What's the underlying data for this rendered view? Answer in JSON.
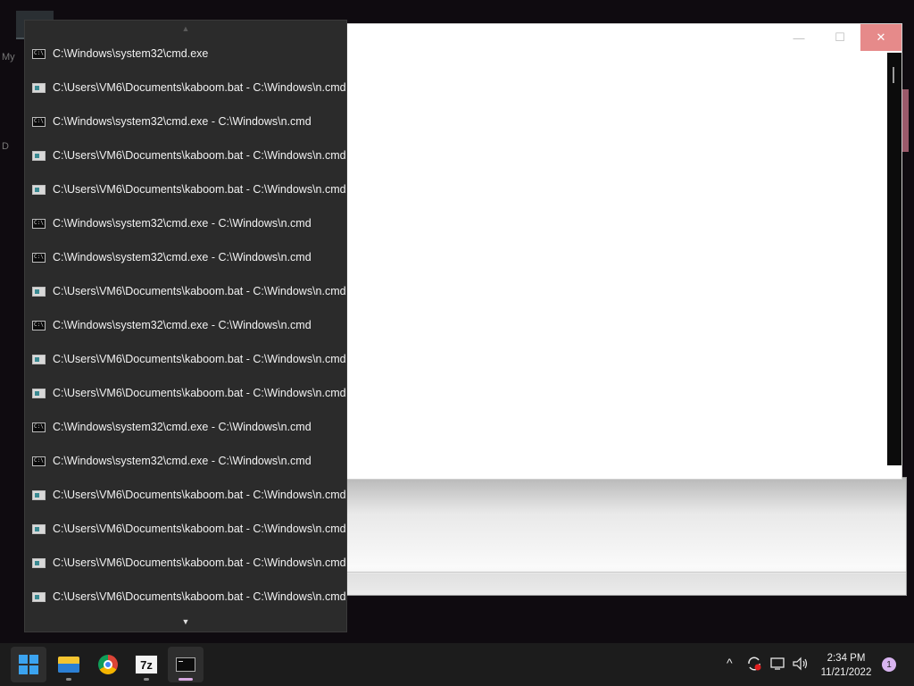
{
  "desktop": {
    "side_labels": [
      "My",
      "D"
    ]
  },
  "window": {
    "minimize": "—",
    "maximize": "☐",
    "close": "✕"
  },
  "menu": {
    "scroll_up": "▲",
    "scroll_down": "▼",
    "items": [
      {
        "icon": "cmd-icon",
        "label": "C:\\Windows\\system32\\cmd.exe"
      },
      {
        "icon": "bat-file-icon",
        "label": "C:\\Users\\VM6\\Documents\\kaboom.bat - C:\\Windows\\n.cmd"
      },
      {
        "icon": "cmd-icon",
        "label": "C:\\Windows\\system32\\cmd.exe - C:\\Windows\\n.cmd"
      },
      {
        "icon": "bat-file-icon",
        "label": "C:\\Users\\VM6\\Documents\\kaboom.bat - C:\\Windows\\n.cmd"
      },
      {
        "icon": "bat-file-icon",
        "label": "C:\\Users\\VM6\\Documents\\kaboom.bat - C:\\Windows\\n.cmd"
      },
      {
        "icon": "cmd-icon",
        "label": "C:\\Windows\\system32\\cmd.exe - C:\\Windows\\n.cmd"
      },
      {
        "icon": "cmd-icon",
        "label": "C:\\Windows\\system32\\cmd.exe - C:\\Windows\\n.cmd"
      },
      {
        "icon": "bat-file-icon",
        "label": "C:\\Users\\VM6\\Documents\\kaboom.bat - C:\\Windows\\n.cmd"
      },
      {
        "icon": "cmd-icon",
        "label": "C:\\Windows\\system32\\cmd.exe - C:\\Windows\\n.cmd"
      },
      {
        "icon": "bat-file-icon",
        "label": "C:\\Users\\VM6\\Documents\\kaboom.bat - C:\\Windows\\n.cmd"
      },
      {
        "icon": "bat-file-icon",
        "label": "C:\\Users\\VM6\\Documents\\kaboom.bat - C:\\Windows\\n.cmd"
      },
      {
        "icon": "cmd-icon",
        "label": "C:\\Windows\\system32\\cmd.exe - C:\\Windows\\n.cmd"
      },
      {
        "icon": "cmd-icon",
        "label": "C:\\Windows\\system32\\cmd.exe - C:\\Windows\\n.cmd"
      },
      {
        "icon": "bat-file-icon",
        "label": "C:\\Users\\VM6\\Documents\\kaboom.bat - C:\\Windows\\n.cmd"
      },
      {
        "icon": "bat-file-icon",
        "label": "C:\\Users\\VM6\\Documents\\kaboom.bat - C:\\Windows\\n.cmd"
      },
      {
        "icon": "bat-file-icon",
        "label": "C:\\Users\\VM6\\Documents\\kaboom.bat - C:\\Windows\\n.cmd"
      },
      {
        "icon": "bat-file-icon",
        "label": "C:\\Users\\VM6\\Documents\\kaboom.bat - C:\\Windows\\n.cmd"
      }
    ]
  },
  "taskbar": {
    "apps": [
      {
        "name": "start-button",
        "icon": "windows-logo-icon"
      },
      {
        "name": "file-explorer-button",
        "icon": "folder-icon"
      },
      {
        "name": "chrome-button",
        "icon": "chrome-icon"
      },
      {
        "name": "7zip-button",
        "icon": "7zip-icon",
        "label": "7z"
      },
      {
        "name": "terminal-button",
        "icon": "terminal-icon"
      }
    ],
    "tray": {
      "chevron": "^",
      "time": "2:34 PM",
      "date": "11/21/2022",
      "notification_count": "1"
    }
  }
}
